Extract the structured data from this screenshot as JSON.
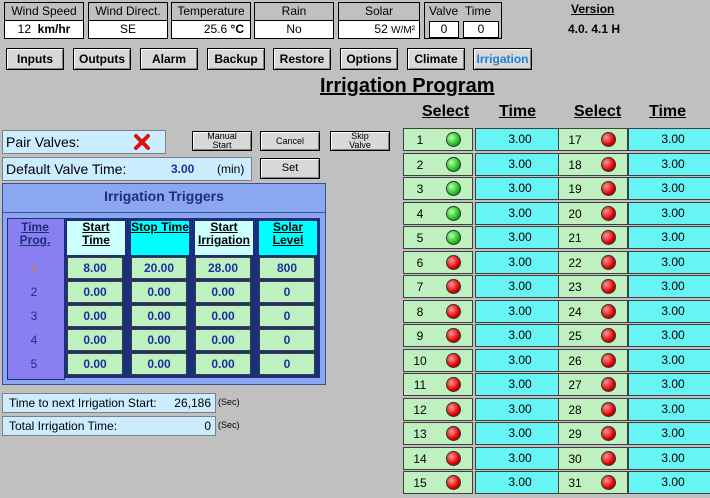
{
  "status": {
    "wind_speed": {
      "label": "Wind Speed",
      "value": "12",
      "unit": "km/hr"
    },
    "wind_direct": {
      "label": "Wind Direct.",
      "value": "SE"
    },
    "temperature": {
      "label": "Temperature",
      "value": "25.6",
      "unit": "°C"
    },
    "rain": {
      "label": "Rain",
      "value": "No"
    },
    "solar": {
      "label": "Solar",
      "value": "52",
      "unit": "W/M²"
    },
    "valve": {
      "label": "Valve",
      "value": "0"
    },
    "time": {
      "label": "Time",
      "value": "0"
    }
  },
  "version": {
    "label": "Version",
    "value": "4.0. 4.1 H"
  },
  "nav": {
    "inputs": "Inputs",
    "outputs": "Outputs",
    "alarm": "Alarm",
    "backup": "Backup",
    "restore": "Restore",
    "options": "Options",
    "climate": "Climate",
    "irrigation": "Irrigation"
  },
  "title": "Irrigation Program",
  "grid_headers": {
    "select": "Select",
    "time": "Time"
  },
  "pair_valves": {
    "label": "Pair Valves:",
    "icon": "red-x-icon"
  },
  "default_valve_time": {
    "label": "Default Valve Time:",
    "value": "3.00",
    "unit": "(min)"
  },
  "buttons": {
    "manual_start": "Manual Start",
    "cancel": "Cancel",
    "skip_valve": "Skip Valve",
    "set": "Set"
  },
  "triggers": {
    "title": "Irrigation Triggers",
    "headers": {
      "time_prog": "Time Prog.",
      "start_time": "Start Time",
      "stop_time": "Stop Time",
      "start_irrigation": "Start Irrigation",
      "solar_level": "Solar Level"
    },
    "rows": [
      {
        "prog": "1",
        "start": "8.00",
        "stop": "20.00",
        "irr": "28.00",
        "solar": "800"
      },
      {
        "prog": "2",
        "start": "0.00",
        "stop": "0.00",
        "irr": "0.00",
        "solar": "0"
      },
      {
        "prog": "3",
        "start": "0.00",
        "stop": "0.00",
        "irr": "0.00",
        "solar": "0"
      },
      {
        "prog": "4",
        "start": "0.00",
        "stop": "0.00",
        "irr": "0.00",
        "solar": "0"
      },
      {
        "prog": "5",
        "start": "0.00",
        "stop": "0.00",
        "irr": "0.00",
        "solar": "0"
      }
    ]
  },
  "next_start": {
    "label": "Time to next Irrigation Start:",
    "value": "26,186",
    "unit": "(Sec)"
  },
  "total_time": {
    "label": "Total Irrigation Time:",
    "value": "0",
    "unit": "(Sec)"
  },
  "valves_left": [
    {
      "num": "1",
      "on": true,
      "time": "3.00"
    },
    {
      "num": "2",
      "on": true,
      "time": "3.00"
    },
    {
      "num": "3",
      "on": true,
      "time": "3.00"
    },
    {
      "num": "4",
      "on": true,
      "time": "3.00"
    },
    {
      "num": "5",
      "on": true,
      "time": "3.00"
    },
    {
      "num": "6",
      "on": false,
      "time": "3.00"
    },
    {
      "num": "7",
      "on": false,
      "time": "3.00"
    },
    {
      "num": "8",
      "on": false,
      "time": "3.00"
    },
    {
      "num": "9",
      "on": false,
      "time": "3.00"
    },
    {
      "num": "10",
      "on": false,
      "time": "3.00"
    },
    {
      "num": "11",
      "on": false,
      "time": "3.00"
    },
    {
      "num": "12",
      "on": false,
      "time": "3.00"
    },
    {
      "num": "13",
      "on": false,
      "time": "3.00"
    },
    {
      "num": "14",
      "on": false,
      "time": "3.00"
    },
    {
      "num": "15",
      "on": false,
      "time": "3.00"
    }
  ],
  "valves_right": [
    {
      "num": "17",
      "on": false,
      "time": "3.00"
    },
    {
      "num": "18",
      "on": false,
      "time": "3.00"
    },
    {
      "num": "19",
      "on": false,
      "time": "3.00"
    },
    {
      "num": "20",
      "on": false,
      "time": "3.00"
    },
    {
      "num": "21",
      "on": false,
      "time": "3.00"
    },
    {
      "num": "22",
      "on": false,
      "time": "3.00"
    },
    {
      "num": "23",
      "on": false,
      "time": "3.00"
    },
    {
      "num": "24",
      "on": false,
      "time": "3.00"
    },
    {
      "num": "25",
      "on": false,
      "time": "3.00"
    },
    {
      "num": "26",
      "on": false,
      "time": "3.00"
    },
    {
      "num": "27",
      "on": false,
      "time": "3.00"
    },
    {
      "num": "28",
      "on": false,
      "time": "3.00"
    },
    {
      "num": "29",
      "on": false,
      "time": "3.00"
    },
    {
      "num": "30",
      "on": false,
      "time": "3.00"
    },
    {
      "num": "31",
      "on": false,
      "time": "3.00"
    }
  ]
}
